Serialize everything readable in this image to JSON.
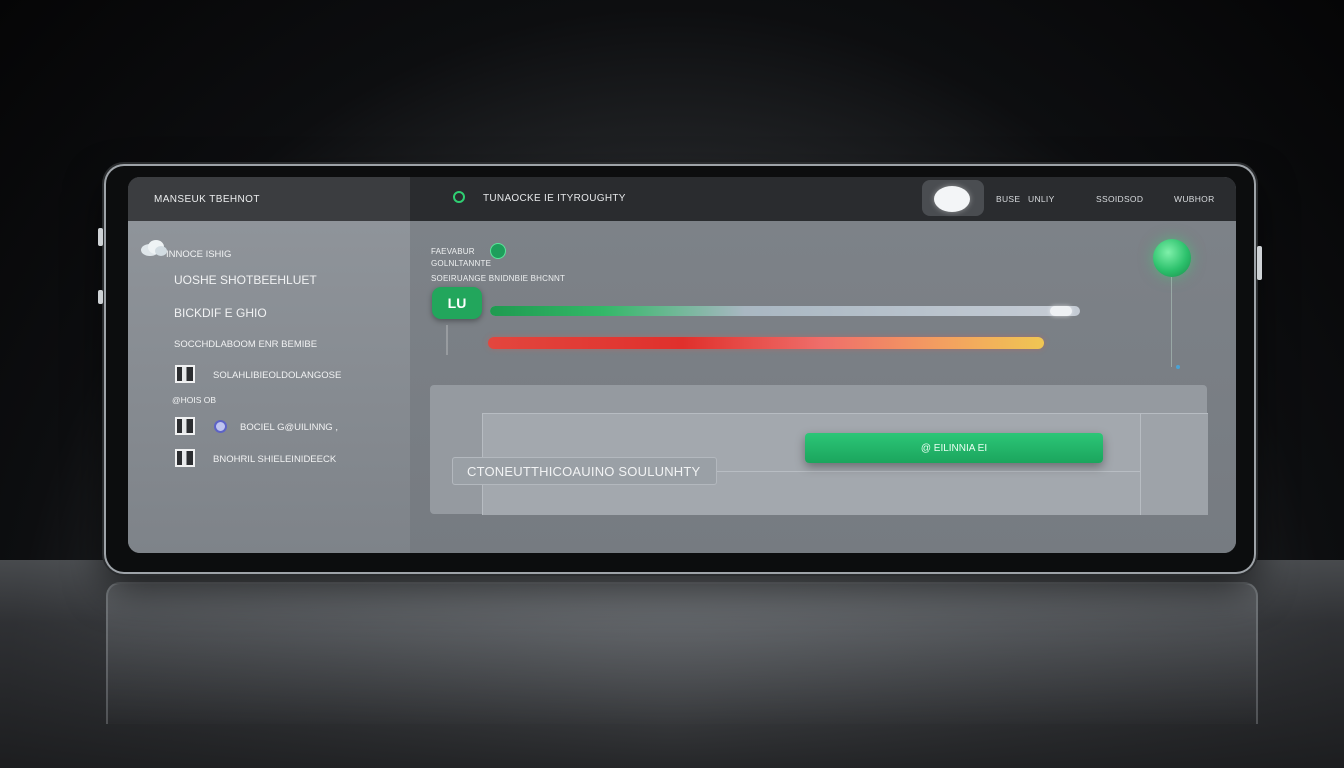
{
  "header": {
    "brand": "MANSEUK TBEHNOT",
    "title": "TUNAOCKE IE ITYROUGHTY",
    "links": [
      "BUSE",
      "UNLIY",
      "SSOIDSOD",
      "WUBHOR"
    ]
  },
  "sidebar": {
    "heading": "INNOCE ISHIG",
    "items": [
      {
        "label": "UOSHE SHOTBEEHLUET"
      },
      {
        "label": "BICKDIF E GHIO"
      },
      {
        "label": "SOCCHDLABOOM ENR BEMIBE"
      },
      {
        "label": "SOLAHLIBIEOLDOLANGOSE"
      },
      {
        "label": "@HOIS OB"
      },
      {
        "label": "BOCIEL G@UILINNG ,"
      },
      {
        "label": "BNOHRIL SHIELEINIDEECK"
      }
    ]
  },
  "main": {
    "label_1": "FAEVABUR",
    "label_2": "GOLNLTANNTE",
    "label_3": "SOEIRUANGE BNIDNBIE BHCNNT",
    "badge": "LU",
    "progress_green": 0.96,
    "progress_gradient": 1.0,
    "action_button": "@ EILINNIA EI",
    "field_value": "CTONEUTTHICOAUINO  SOULUNHTY"
  },
  "colors": {
    "accent_green": "#22a65c",
    "bar_red": "#e0302c",
    "bar_yellow": "#f0c653"
  },
  "icons": [
    "cloud-icon",
    "qr-icon",
    "globe-icon",
    "status-ring-icon",
    "toggle-icon",
    "orb-icon"
  ]
}
